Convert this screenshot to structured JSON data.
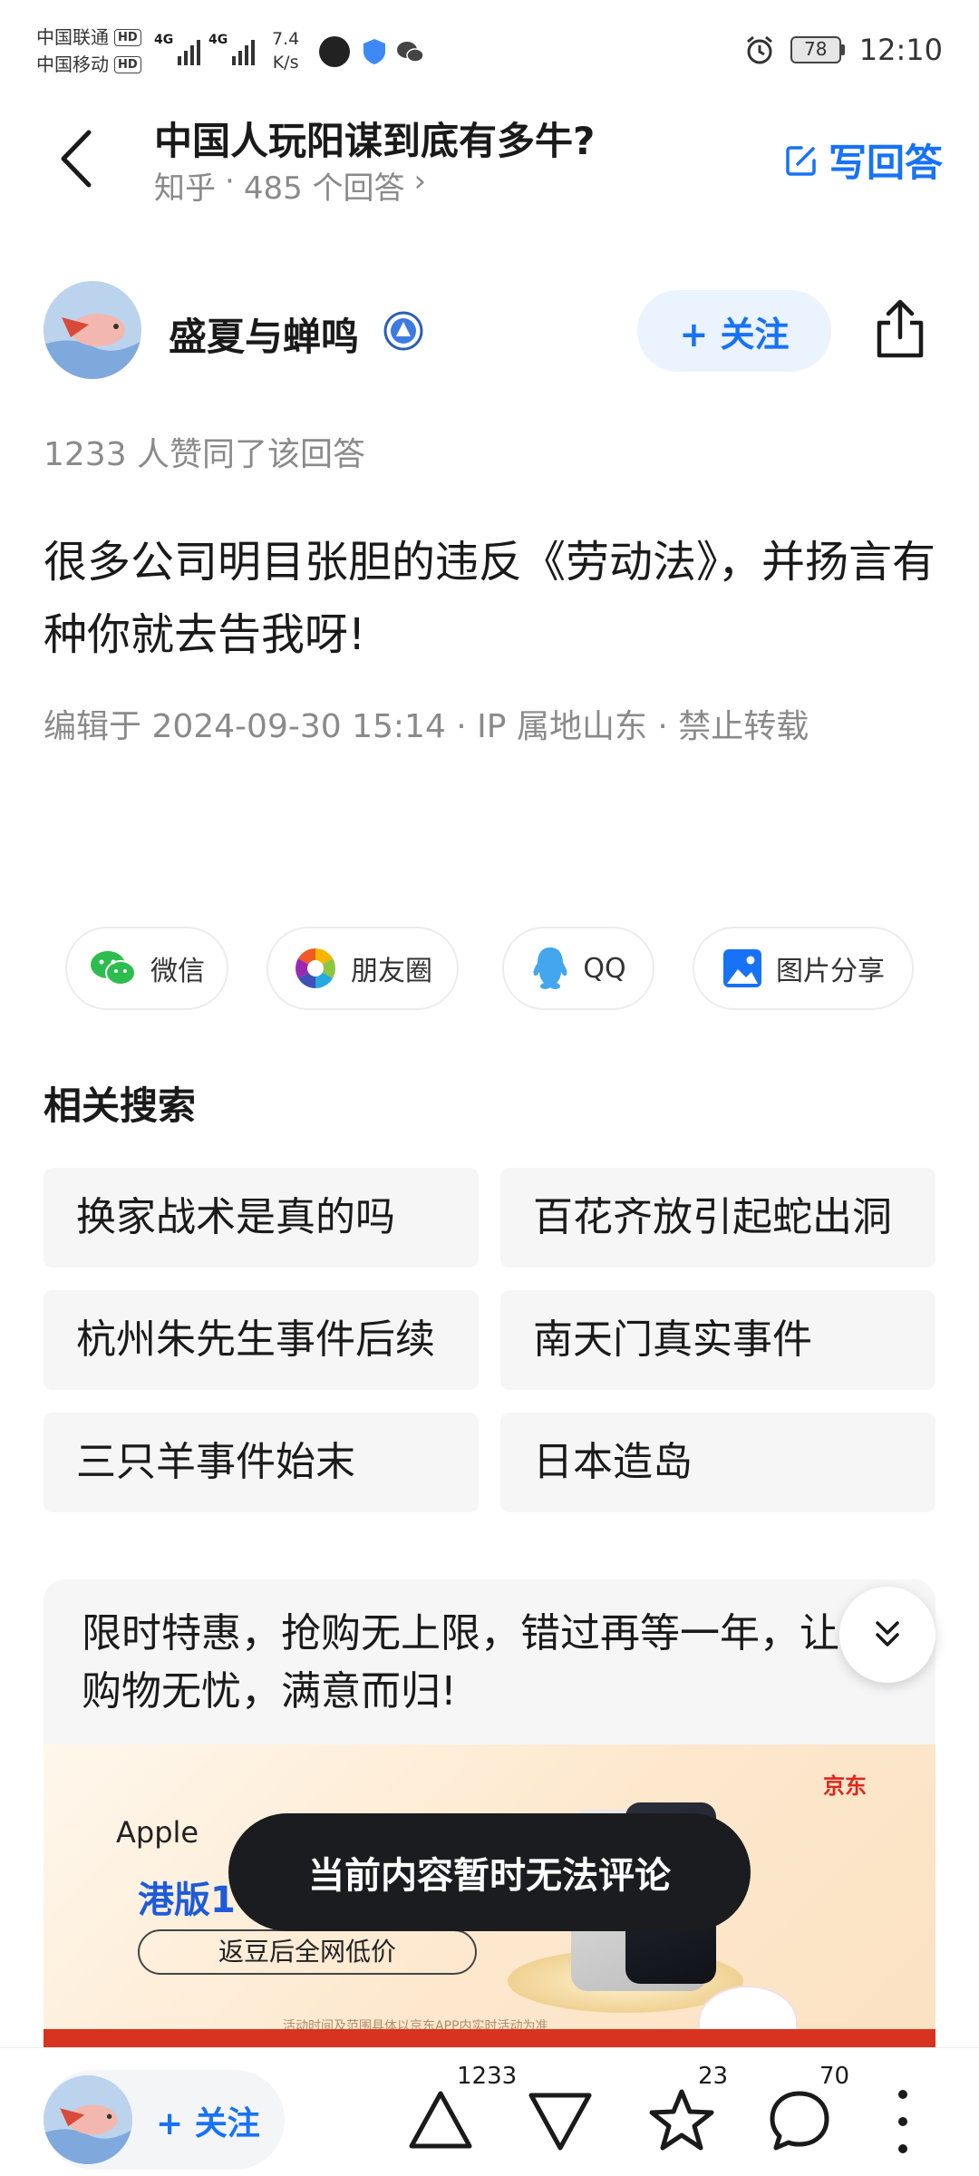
{
  "status_bar": {
    "carrier1": "中国联通",
    "carrier2": "中国移动",
    "hd": "HD",
    "signal_label": "4G",
    "net_speed_value": "7.4",
    "net_speed_unit": "K/s",
    "battery": "78",
    "time": "12:10"
  },
  "header": {
    "question_title": "中国人玩阳谋到底有多牛?",
    "source": "知乎",
    "separator": "·",
    "answer_count": "485 个回答",
    "chevron": "›",
    "write_answer": "写回答"
  },
  "author": {
    "name": "盛夏与蝉鸣",
    "follow_label": "+ 关注"
  },
  "answer": {
    "upvote_text": "1233 人赞同了该回答",
    "content": "很多公司明目张胆的违反《劳动法》，并扬言有种你就去告我呀!",
    "edited_text": "编辑于 2024-09-30 15:14 · IP 属地山东 · 禁止转载"
  },
  "share": {
    "wechat": "微信",
    "moments": "朋友圈",
    "qq": "QQ",
    "image_share": "图片分享"
  },
  "related": {
    "title": "相关搜索",
    "items": [
      "换家战术是真的吗",
      "百花齐放引起蛇出洞",
      "杭州朱先生事件后续",
      "南天门真实事件",
      "三只羊事件始末",
      "日本造岛"
    ]
  },
  "ad": {
    "text": "限时特惠，抢购无上限，错过再等一年，让你购物无忧，满意而归!",
    "banner_apple": "Apple",
    "banner_hk": "港版1",
    "banner_pill": "返豆后全网低价",
    "banner_brand": "京东",
    "banner_fine_print": "活动时间及范围具体以京东APP内实时活动为准"
  },
  "toast": "当前内容暂时无法评论",
  "bottom_bar": {
    "follow_label": "+ 关注",
    "upvote_count": "1233",
    "favorite_count": "23",
    "comment_count": "70"
  },
  "colors": {
    "accent": "#1772f6",
    "follow_bg": "#ebf3fe",
    "muted_text": "#8a8a8a",
    "chip_bg": "#f6f6f7",
    "toast_bg": "#1b1c1f"
  },
  "icons": {
    "back": "chevron-left-icon",
    "write": "edit-icon",
    "share": "share-icon",
    "badge": "verified-badge-icon",
    "upvote": "triangle-up-icon",
    "downvote": "triangle-down-icon",
    "favorite": "star-icon",
    "comment": "comment-icon",
    "more": "more-vertical-icon",
    "collapse": "double-chevron-down-icon"
  }
}
